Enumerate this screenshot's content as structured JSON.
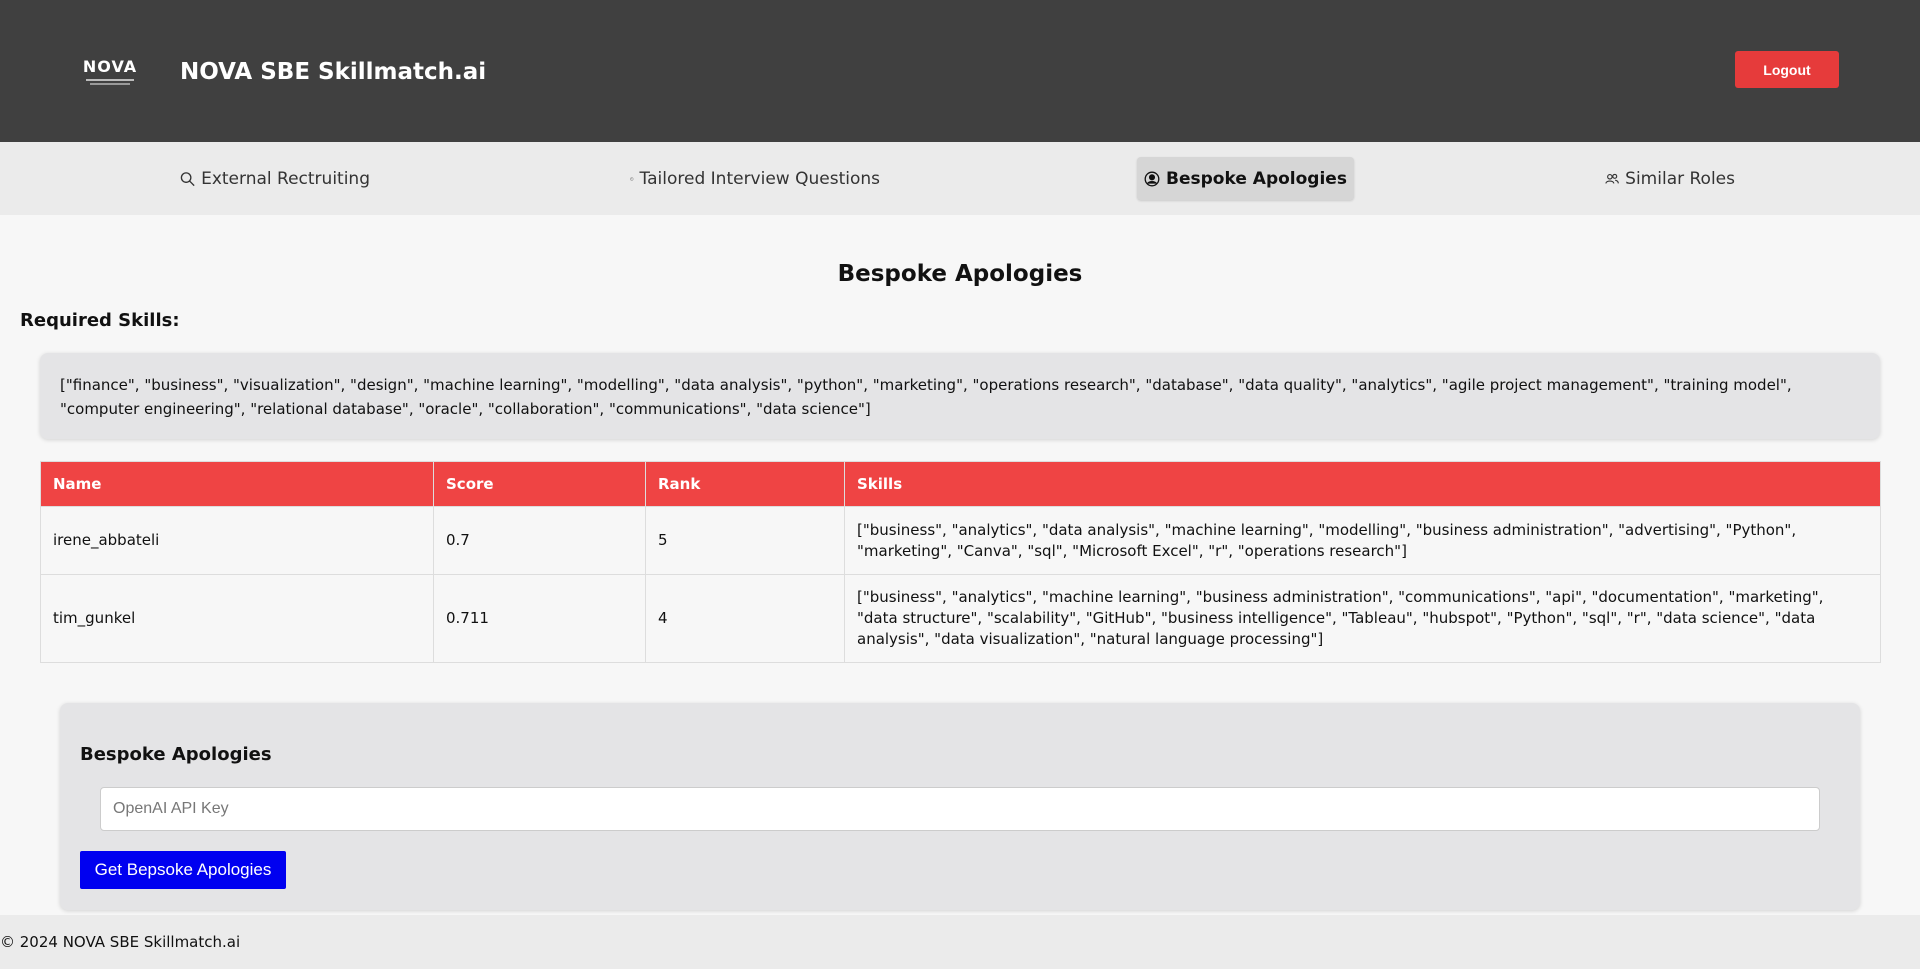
{
  "header": {
    "logo_text": "NOVA",
    "app_title": "NOVA SBE Skillmatch.ai",
    "logout_label": "Logout"
  },
  "nav": {
    "items": [
      {
        "label": "External Rectruiting",
        "icon": "search-icon"
      },
      {
        "label": "Tailored Interview Questions",
        "icon": "clock-icon"
      },
      {
        "label": "Bespoke Apologies",
        "icon": "user-circle-icon",
        "active": true
      },
      {
        "label": "Similar Roles",
        "icon": "users-icon"
      }
    ]
  },
  "main": {
    "title": "Bespoke Apologies",
    "required_skills_label": "Required Skills:",
    "required_skills_text": "[\"finance\", \"business\", \"visualization\", \"design\", \"machine learning\", \"modelling\", \"data analysis\", \"python\", \"marketing\", \"operations research\", \"database\", \"data quality\", \"analytics\", \"agile project management\", \"training model\", \"computer engineering\", \"relational database\", \"oracle\", \"collaboration\", \"communications\", \"data science\"]",
    "table": {
      "headers": [
        "Name",
        "Score",
        "Rank",
        "Skills"
      ],
      "rows": [
        {
          "name": "irene_abbateli",
          "score": "0.7",
          "rank": "5",
          "skills": "[\"business\", \"analytics\", \"data analysis\", \"machine learning\", \"modelling\", \"business administration\", \"advertising\", \"Python\", \"marketing\", \"Canva\", \"sql\", \"Microsoft Excel\", \"r\", \"operations research\"]"
        },
        {
          "name": "tim_gunkel",
          "score": "0.711",
          "rank": "4",
          "skills": "[\"business\", \"analytics\", \"machine learning\", \"business administration\", \"communications\", \"api\", \"documentation\", \"marketing\", \"data structure\", \"scalability\", \"GitHub\", \"business intelligence\", \"Tableau\", \"hubspot\", \"Python\", \"sql\", \"r\", \"data science\", \"data analysis\", \"data visualization\", \"natural language processing\"]"
        }
      ]
    },
    "apology_panel": {
      "title": "Bespoke Apologies",
      "api_key_placeholder": "OpenAI API Key",
      "api_key_value": "",
      "submit_label": "Get Bepsoke Apologies"
    }
  },
  "footer": {
    "copyright": "© 2024 NOVA SBE Skillmatch.ai"
  },
  "colors": {
    "header_bg": "#404040",
    "accent_red": "#ef4444",
    "logout_red": "#e63b3b",
    "submit_blue": "#0000f0"
  }
}
